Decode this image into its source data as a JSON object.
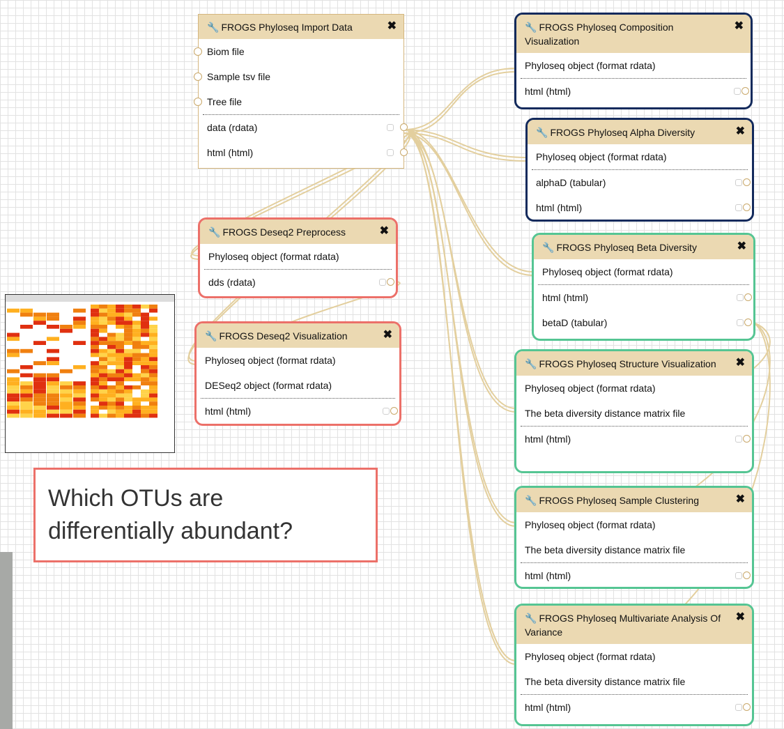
{
  "nodes": [
    {
      "id": "import",
      "title": "FROGS Phyloseq Import Data",
      "highlight": "none",
      "inputs": [
        "Biom file",
        "Sample tsv file",
        "Tree file"
      ],
      "outputs": [
        "data (rdata)",
        "html (html)"
      ]
    },
    {
      "id": "preprocess",
      "title": "FROGS Deseq2 Preprocess",
      "highlight": "red",
      "inputs": [
        "Phyloseq object (format rdata)"
      ],
      "outputs": [
        "dds (rdata)"
      ]
    },
    {
      "id": "deseqviz",
      "title": "FROGS Deseq2 Visualization",
      "highlight": "red",
      "inputs": [
        "Phyloseq object (format rdata)",
        "DESeq2 object (format rdata)"
      ],
      "outputs": [
        "html (html)"
      ]
    },
    {
      "id": "composition",
      "title": "FROGS Phyloseq Composition Visualization",
      "highlight": "navy",
      "inputs": [
        "Phyloseq object (format rdata)"
      ],
      "outputs": [
        "html (html)"
      ]
    },
    {
      "id": "alpha",
      "title": "FROGS Phyloseq Alpha Diversity",
      "highlight": "navy",
      "inputs": [
        "Phyloseq object (format rdata)"
      ],
      "outputs": [
        "alphaD (tabular)",
        "html (html)"
      ]
    },
    {
      "id": "beta",
      "title": "FROGS Phyloseq Beta Diversity",
      "highlight": "green",
      "inputs": [
        "Phyloseq object (format rdata)"
      ],
      "outputs": [
        "html (html)",
        "betaD (tabular)"
      ]
    },
    {
      "id": "structure",
      "title": "FROGS Phyloseq Structure Visualization",
      "highlight": "green",
      "inputs": [
        "Phyloseq object (format rdata)",
        "The beta diversity distance matrix file"
      ],
      "outputs": [
        "html (html)"
      ]
    },
    {
      "id": "clustering",
      "title": "FROGS Phyloseq Sample Clustering",
      "highlight": "green",
      "inputs": [
        "Phyloseq object (format rdata)",
        "The beta diversity distance matrix file"
      ],
      "outputs": [
        "html (html)"
      ]
    },
    {
      "id": "manova",
      "title": "FROGS Phyloseq Multivariate Analysis Of Variance",
      "highlight": "green",
      "inputs": [
        "Phyloseq object (format rdata)",
        "The beta diversity distance matrix file"
      ],
      "outputs": [
        "html (html)"
      ]
    }
  ],
  "icons": {
    "tool": "wrench-icon",
    "close": "close-icon",
    "terminal": "connector-circle-icon",
    "checkbox": "output-checkbox-icon"
  },
  "callout": {
    "line1": "Which OTUs are",
    "line2": "differentially abundant?"
  },
  "heatmap": {
    "description_icon": "heatmap-thumbnail",
    "palette": [
      "#ffffff",
      "#fff3a0",
      "#ffd34a",
      "#ffb020",
      "#f08010",
      "#e03010"
    ]
  },
  "colors": {
    "highlight_red": "#ec7069",
    "highlight_navy": "#132a5c",
    "highlight_green": "#55c593",
    "wire": "#e3cf9e",
    "node_header": "#ebd9b2"
  }
}
